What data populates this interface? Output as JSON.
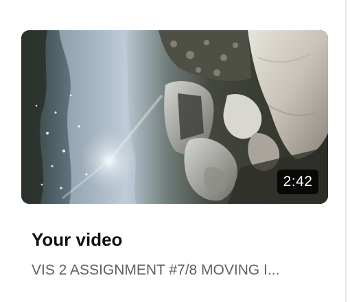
{
  "video_card": {
    "thumbnail_icon": "video-thumbnail-image",
    "duration": "2:42",
    "title": "Your video",
    "subtitle": "VIS 2 ASSIGNMENT #7/8 MOVING I..."
  },
  "colors": {
    "title_text": "#0f0f0f",
    "subtitle_text": "#606060",
    "duration_badge": "#000000",
    "page_background": "#ffffff"
  }
}
